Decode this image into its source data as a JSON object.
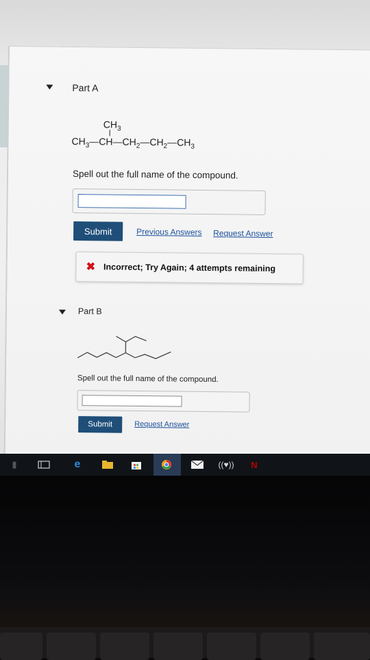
{
  "partA": {
    "heading": "Part A",
    "formula": {
      "branch": "CH3",
      "chain": [
        "CH3",
        "CH",
        "CH2",
        "CH2",
        "CH3"
      ]
    },
    "question": "Spell out the full name of the compound.",
    "answer_value": "",
    "submit_label": "Submit",
    "previous_answers_label": "Previous Answers",
    "request_answer_label": "Request Answer",
    "feedback_text": "Incorrect; Try Again; 4 attempts remaining"
  },
  "partB": {
    "heading": "Part B",
    "question": "Spell out the full name of the compound.",
    "answer_value": "",
    "submit_label": "Submit",
    "request_answer_label": "Request Answer"
  },
  "taskbar": {
    "icons": [
      "task-view-icon",
      "edge-icon",
      "file-explorer-icon",
      "store-icon",
      "chrome-icon",
      "mail-icon",
      "iheartradio-icon",
      "netflix-icon"
    ]
  },
  "colors": {
    "submit_bg": "#1f4e79",
    "link": "#1b4f9c",
    "error": "#d0101a"
  }
}
